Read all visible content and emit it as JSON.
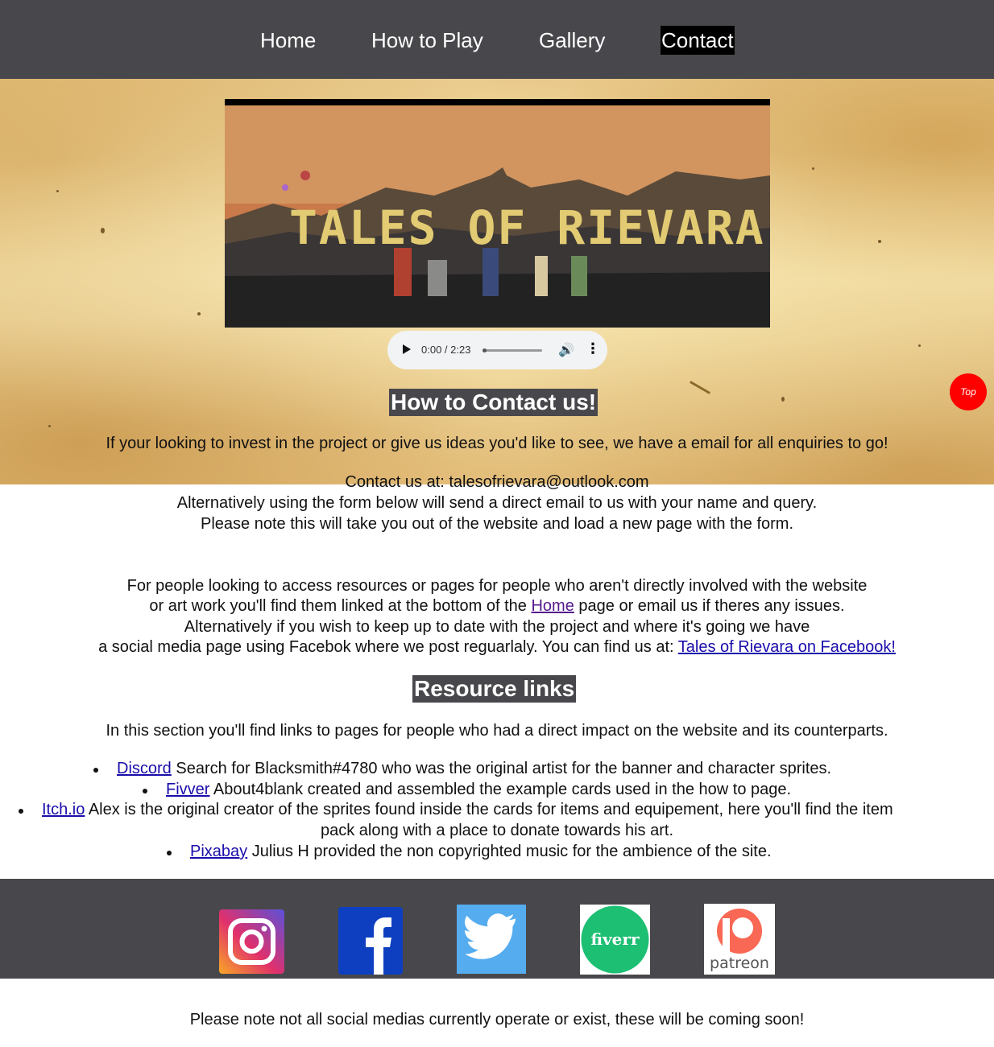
{
  "nav": {
    "items": [
      {
        "label": "Home"
      },
      {
        "label": "How to Play"
      },
      {
        "label": "Gallery"
      },
      {
        "label": "Contact"
      }
    ]
  },
  "banner": {
    "title": "TALES OF RIEVARA"
  },
  "audio": {
    "time": "0:00 / 2:23",
    "progress": 0
  },
  "top_button": {
    "label": "Top"
  },
  "contact": {
    "heading": "How to Contact us!",
    "intro": "If your looking to invest in the project or give us ideas you'd like to see, we have a email for all enquiries to go!",
    "contact_line": "Contact us at: talesofrievara@outlook.com",
    "alt_line1": "Alternatively using the form below will send a direct email to us with your name and query.",
    "alt_line2": "Please note this will take you out of the website and load a new page with the form.",
    "res_line1": "For people looking to access resources or pages for people who aren't directly involved with the website",
    "res_line2_pre": "or art work you'll find them linked at the bottom of the",
    "res_line2_link": "Home",
    "res_line2_post": "page or email us if theres any issues.",
    "res_line3": "Alternatively if you wish to keep up to date with the project and where it's going we have",
    "res_line4_pre": "a social media page using Facebok where we post reguarlaly. You can find us at:",
    "res_line4_link": "Tales of Rievara on Facebook!"
  },
  "resources": {
    "heading": "Resource links",
    "intro": "In this section you'll find links to pages for people who had a direct impact on the website and its counterparts.",
    "items": [
      {
        "link": "Discord",
        "text": "Search for Blacksmith#4780 who was the original artist for the banner and character sprites."
      },
      {
        "link": "Fivver",
        "text": "About4blank created and assembled the example cards used in the how to page."
      },
      {
        "link": "Itch.io",
        "text": "Alex is the original creator of the sprites found inside the cards for items and equipement, here you'll find the item",
        "text2": "pack along with a place to donate towards his art."
      },
      {
        "link": "Pixabay",
        "text": "Julius H provided the non copyrighted music for the ambience of the site."
      }
    ]
  },
  "footer": {
    "icons": [
      "instagram-icon",
      "facebook-icon",
      "twitter-icon",
      "fiverr-icon",
      "patreon-icon"
    ],
    "fiverr_label": "fiverr",
    "patreon_label": "patreon",
    "note": "Please note not all social medias currently operate or exist, these will be coming soon!"
  }
}
